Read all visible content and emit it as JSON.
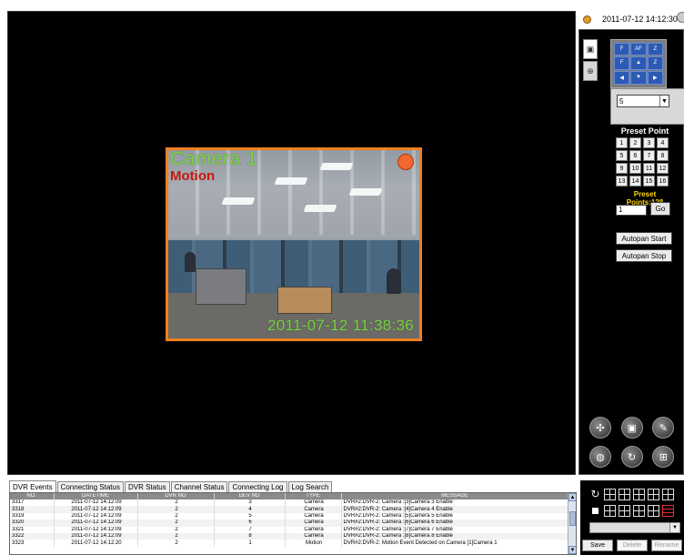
{
  "header": {
    "datetime": "2011-07-12 14:12:30"
  },
  "camera": {
    "name": "Camera 1",
    "event": "Motion",
    "timestamp": "2011-07-12 11:38:36"
  },
  "ptz": {
    "buttons": [
      "F",
      "AF",
      "Z",
      "F",
      "▲",
      "Z",
      "◀",
      "▼",
      "▶"
    ],
    "selected_speed": "5"
  },
  "preset": {
    "title": "Preset Point",
    "points": [
      "1",
      "2",
      "3",
      "4",
      "5",
      "6",
      "7",
      "8",
      "9",
      "10",
      "11",
      "12",
      "13",
      "14",
      "15",
      "16"
    ],
    "count_label": "Preset Points:128",
    "goto_value": "1",
    "go_label": "Go",
    "autopan_start_label": "Autopan Start",
    "autopan_stop_label": "Autopan Stop"
  },
  "tabs": [
    "DVR Events",
    "Connecting Status",
    "DVR Status",
    "Channel Status",
    "Connecting Log",
    "Log Search"
  ],
  "events": {
    "columns": [
      "NO.",
      "DATETIME",
      "DVR NO",
      "DEV NO",
      "TYPE",
      "MESSAGE"
    ],
    "rows": [
      [
        "3317",
        "2011-07-12 14:12:09",
        "2",
        "3",
        "Camera",
        "DVR#2:DVR-2: Camera :[3]Camera 3 Enable"
      ],
      [
        "3318",
        "2011-07-12 14:12:09",
        "2",
        "4",
        "Camera",
        "DVR#2:DVR-2: Camera :[4]Camera 4 Enable"
      ],
      [
        "3319",
        "2011-07-12 14:12:09",
        "2",
        "5",
        "Camera",
        "DVR#2:DVR-2: Camera :[5]Camera 5 Enable"
      ],
      [
        "3320",
        "2011-07-12 14:12:09",
        "2",
        "6",
        "Camera",
        "DVR#2:DVR-2: Camera :[6]Camera 6 Enable"
      ],
      [
        "3321",
        "2011-07-12 14:12:09",
        "2",
        "7",
        "Camera",
        "DVR#2:DVR-2: Camera :[7]Camera 7 Enable"
      ],
      [
        "3322",
        "2011-07-12 14:12:09",
        "2",
        "8",
        "Camera",
        "DVR#2:DVR-2: Camera :[8]Camera 8 Enable"
      ],
      [
        "3323",
        "2011-07-12 14:12:20",
        "2",
        "1",
        "Motion",
        "DVR#2:DVR-2: Motion Event Detected on Camera [1]Camera 1"
      ]
    ]
  },
  "layout_panel": {
    "save_label": "Save",
    "delete_label": "Delete",
    "rename_label": "Rename"
  },
  "colors": {
    "camera_border": "#f08020",
    "camera_name": "#7dd54a",
    "motion_text": "#c41a10",
    "preset_count": "#ffd800",
    "ptz_button": "#2c5ab4"
  }
}
